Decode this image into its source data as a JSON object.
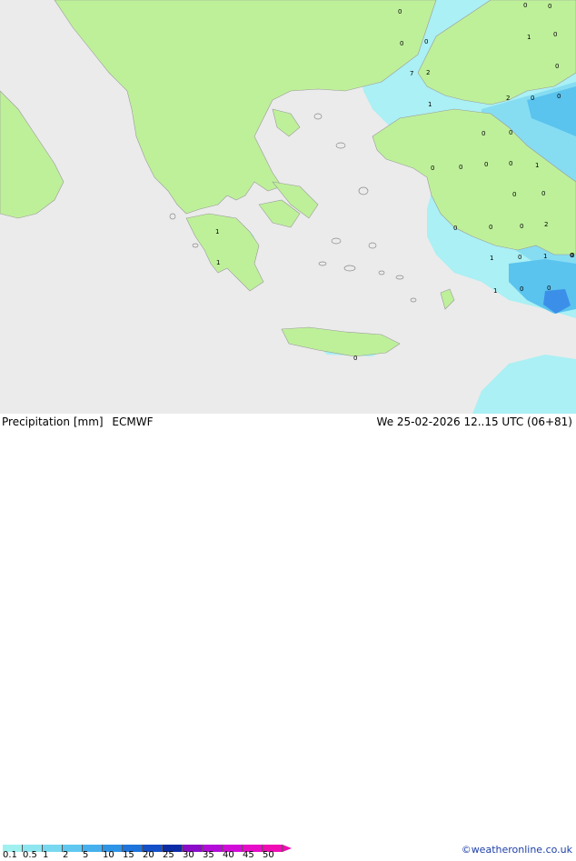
{
  "title": "Precipitation [mm]",
  "model": "ECMWF",
  "valid_time": "We 25-02-2026 12..15 UTC (06+81)",
  "credit": "©weatheronline.co.uk",
  "legend": {
    "ticks": [
      "0.1",
      "0.5",
      "1",
      "2",
      "5",
      "10",
      "15",
      "20",
      "25",
      "30",
      "35",
      "40",
      "45",
      "50"
    ],
    "colors": [
      "#a0f0f0",
      "#8ee6f0",
      "#78d8f0",
      "#60c8f0",
      "#46b0ee",
      "#2e94e6",
      "#1e74da",
      "#1450c8",
      "#0c2ca6",
      "#8a0cc8",
      "#b40cd8",
      "#d20cd8",
      "#e60cc8",
      "#f00cb4"
    ]
  },
  "map_labels": [
    "0",
    "0",
    "0",
    "1",
    "0",
    "0",
    "0",
    "0",
    "2",
    "7",
    "0",
    "0",
    "1",
    "2",
    "0",
    "0",
    "0",
    "0",
    "0",
    "0",
    "1",
    "0",
    "0",
    "0",
    "0",
    "0",
    "2",
    "1",
    "1",
    "1",
    "0",
    "1",
    "0",
    "1",
    "0",
    "0",
    "0",
    "0"
  ],
  "colors": {
    "sea": "#ebebeb",
    "land": "#bef09a",
    "precip_light": "#aaf0f4",
    "precip_mid": "#86ddf2",
    "precip_strong": "#5ac3ee",
    "precip_heavy": "#3c8fe8"
  }
}
